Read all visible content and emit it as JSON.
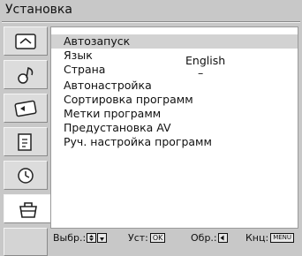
{
  "title": "Установка",
  "sidebar": {
    "icons": [
      {
        "name": "picture-icon"
      },
      {
        "name": "sound-icon"
      },
      {
        "name": "screen-icon"
      },
      {
        "name": "features-icon"
      },
      {
        "name": "timer-icon"
      },
      {
        "name": "setup-toolbox-icon",
        "selected": true
      }
    ]
  },
  "menu": {
    "items": [
      {
        "label": "Автозапуск",
        "value": ""
      },
      {
        "label": "Язык",
        "value": "English"
      },
      {
        "label": "Страна",
        "value": "–"
      },
      {
        "label": "Автонастройка",
        "value": ""
      },
      {
        "label": "Сортировка программ",
        "value": ""
      },
      {
        "label": "Метки программ",
        "value": ""
      },
      {
        "label": "Предустановка AV",
        "value": ""
      },
      {
        "label": "Руч. настройка программ",
        "value": ""
      }
    ],
    "highlighted_index": 0
  },
  "footer": {
    "select_label": "Выбр.:",
    "set_label": "Уст:",
    "set_key": "OK",
    "back_label": "Обр.:",
    "end_label": "Кнц:",
    "end_key": "MENU"
  }
}
